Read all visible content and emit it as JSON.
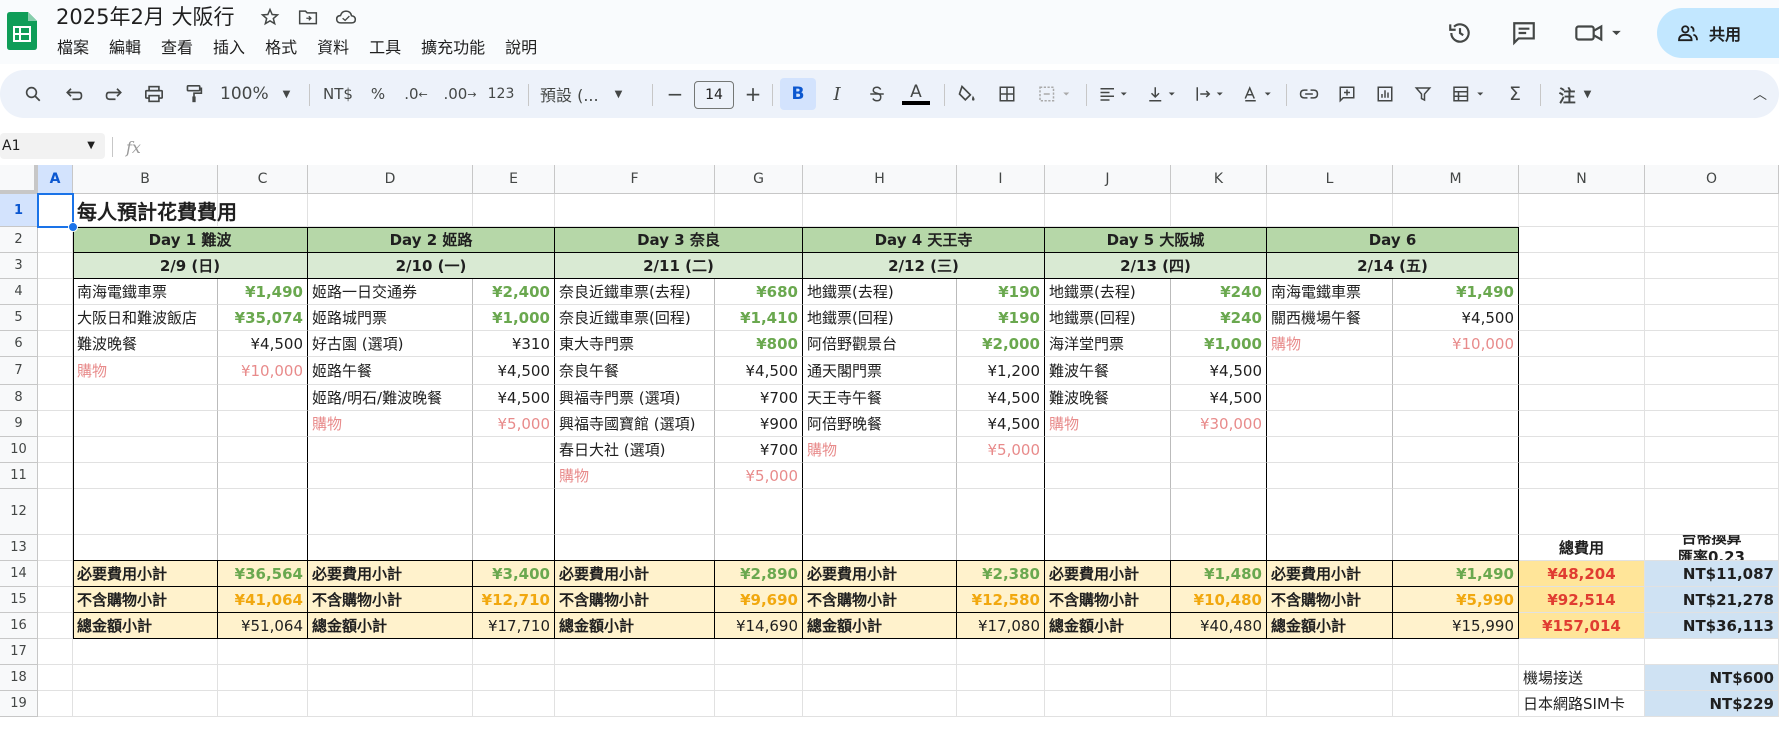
{
  "doc": {
    "title": "2025年2月 大阪行"
  },
  "menu": [
    "檔案",
    "編輯",
    "查看",
    "插入",
    "格式",
    "資料",
    "工具",
    "擴充功能",
    "說明"
  ],
  "share": {
    "label": "共用"
  },
  "toolbar": {
    "zoom": "100%",
    "currency": "NT$",
    "percent": "%",
    "dec_minus": ".0",
    "dec_plus": ".00",
    "number_format": "123",
    "font": "預設 (...",
    "font_size": "14",
    "bold": "B",
    "italic": "I",
    "ime": "注"
  },
  "formula": {
    "name_box": "A1",
    "fx": "fx"
  },
  "columns": [
    "A",
    "B",
    "C",
    "D",
    "E",
    "F",
    "G",
    "H",
    "I",
    "J",
    "K",
    "L",
    "M",
    "N",
    "O"
  ],
  "rows": [
    "1",
    "2",
    "3",
    "4",
    "5",
    "6",
    "7",
    "8",
    "9",
    "10",
    "11",
    "12",
    "13",
    "14",
    "15",
    "16",
    "17",
    "18",
    "19"
  ],
  "sheet": {
    "title": "每人預計花費費用",
    "days": [
      {
        "name": "Day 1 難波",
        "date": "2/9 (日)",
        "items": [
          {
            "label": "南海電鐵車票",
            "amount": "¥1,490",
            "style": "green"
          },
          {
            "label": "大阪日和難波飯店",
            "amount": "¥35,074",
            "style": "green"
          },
          {
            "label": "難波晚餐",
            "amount": "¥4,500",
            "style": ""
          },
          {
            "label": "購物",
            "amount": "¥10,000",
            "style": "pink"
          }
        ],
        "subtotal_required": "¥36,564",
        "subtotal_no_shopping": "¥41,064",
        "total": "¥51,064"
      },
      {
        "name": "Day 2 姬路",
        "date": "2/10 (一)",
        "items": [
          {
            "label": "姬路一日交通券",
            "amount": "¥2,400",
            "style": "green"
          },
          {
            "label": "姬路城門票",
            "amount": "¥1,000",
            "style": "green"
          },
          {
            "label": "好古園 (選項)",
            "amount": "¥310",
            "style": ""
          },
          {
            "label": "姬路午餐",
            "amount": "¥4,500",
            "style": ""
          },
          {
            "label": "姬路/明石/難波晚餐",
            "amount": "¥4,500",
            "style": ""
          },
          {
            "label": "購物",
            "amount": "¥5,000",
            "style": "pink"
          }
        ],
        "subtotal_required": "¥3,400",
        "subtotal_no_shopping": "¥12,710",
        "total": "¥17,710"
      },
      {
        "name": "Day 3 奈良",
        "date": "2/11 (二)",
        "items": [
          {
            "label": "奈良近鐵車票(去程)",
            "amount": "¥680",
            "style": "green"
          },
          {
            "label": "奈良近鐵車票(回程)",
            "amount": "¥1,410",
            "style": "green"
          },
          {
            "label": "東大寺門票",
            "amount": "¥800",
            "style": "green"
          },
          {
            "label": "奈良午餐",
            "amount": "¥4,500",
            "style": ""
          },
          {
            "label": "興福寺門票 (選項)",
            "amount": "¥700",
            "style": ""
          },
          {
            "label": "興福寺國寶館 (選項)",
            "amount": "¥900",
            "style": ""
          },
          {
            "label": "春日大社 (選項)",
            "amount": "¥700",
            "style": ""
          },
          {
            "label": "購物",
            "amount": "¥5,000",
            "style": "pink"
          }
        ],
        "subtotal_required": "¥2,890",
        "subtotal_no_shopping": "¥9,690",
        "total": "¥14,690"
      },
      {
        "name": "Day 4 天王寺",
        "date": "2/12 (三)",
        "items": [
          {
            "label": "地鐵票(去程)",
            "amount": "¥190",
            "style": "green"
          },
          {
            "label": "地鐵票(回程)",
            "amount": "¥190",
            "style": "green"
          },
          {
            "label": "阿倍野觀景台",
            "amount": "¥2,000",
            "style": "green"
          },
          {
            "label": "通天閣門票",
            "amount": "¥1,200",
            "style": ""
          },
          {
            "label": "天王寺午餐",
            "amount": "¥4,500",
            "style": ""
          },
          {
            "label": "阿倍野晚餐",
            "amount": "¥4,500",
            "style": ""
          },
          {
            "label": "購物",
            "amount": "¥5,000",
            "style": "pink"
          }
        ],
        "subtotal_required": "¥2,380",
        "subtotal_no_shopping": "¥12,580",
        "total": "¥17,080"
      },
      {
        "name": "Day 5 大阪城",
        "date": "2/13 (四)",
        "items": [
          {
            "label": "地鐵票(去程)",
            "amount": "¥240",
            "style": "green"
          },
          {
            "label": "地鐵票(回程)",
            "amount": "¥240",
            "style": "green"
          },
          {
            "label": "海洋堂門票",
            "amount": "¥1,000",
            "style": "green"
          },
          {
            "label": "難波午餐",
            "amount": "¥4,500",
            "style": ""
          },
          {
            "label": "難波晚餐",
            "amount": "¥4,500",
            "style": ""
          },
          {
            "label": "購物",
            "amount": "¥30,000",
            "style": "pink"
          }
        ],
        "subtotal_required": "¥1,480",
        "subtotal_no_shopping": "¥10,480",
        "total": "¥40,480"
      },
      {
        "name": "Day 6",
        "date": "2/14 (五)",
        "items": [
          {
            "label": "南海電鐵車票",
            "amount": "¥1,490",
            "style": "green"
          },
          {
            "label": "關西機場午餐",
            "amount": "¥4,500",
            "style": ""
          },
          {
            "label": "購物",
            "amount": "¥10,000",
            "style": "pink"
          }
        ],
        "subtotal_required": "¥1,490",
        "subtotal_no_shopping": "¥5,990",
        "total": "¥15,990"
      }
    ],
    "labels": {
      "required": "必要費用小計",
      "no_shopping": "不含購物小計",
      "total": "總金額小計"
    },
    "summary": {
      "total_header": "總費用",
      "twd_header_1": "台幣換算",
      "twd_header_2": "匯率0.23",
      "totals": [
        "¥48,204",
        "¥92,514",
        "¥157,014"
      ],
      "twd": [
        "NT$11,087",
        "NT$21,278",
        "NT$36,113"
      ]
    },
    "extras": [
      {
        "label": "機場接送",
        "amount": "NT$600"
      },
      {
        "label": "日本網路SIM卡",
        "amount": "NT$229"
      }
    ]
  },
  "colors": {
    "header_green": "#b6d7a8",
    "date_green": "#d9ead3",
    "subtotal_yellow": "#fff2cc",
    "total_yellow": "#ffe599",
    "twd_blue": "#cfe2f3",
    "amount_green": "#6aa84f",
    "shopping_pink": "#e88b8b",
    "orange": "#f1a80f",
    "red": "#e03c31"
  }
}
